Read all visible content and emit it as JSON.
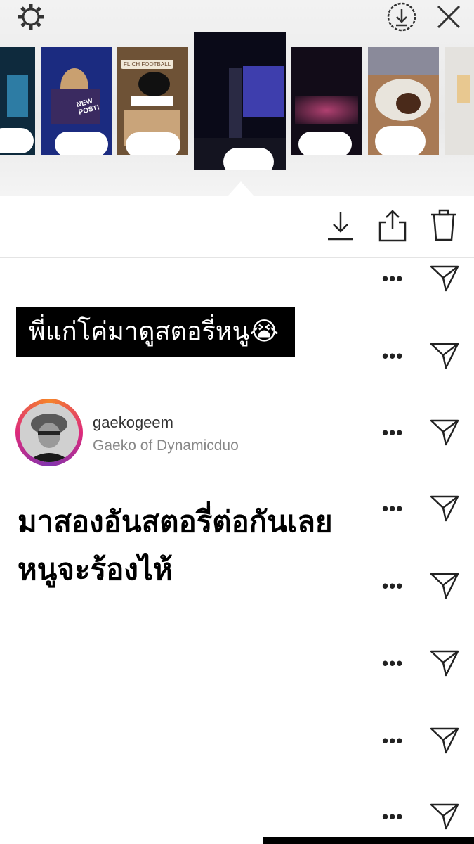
{
  "top_bar": {
    "settings_icon": "gear-icon",
    "save_icon": "download-circle-icon",
    "close_icon": "close-icon"
  },
  "stories": [
    {
      "overlay": "",
      "color": "#0d2a3a"
    },
    {
      "overlay": "NEW POST!",
      "color": "#1a2f7a"
    },
    {
      "overlay": "FLICH FOOTBALL",
      "color": "#7a5a3a"
    },
    {
      "overlay": "",
      "color": "#101022"
    },
    {
      "overlay": "",
      "color": "#1a1020"
    },
    {
      "overlay": "",
      "color": "#a07050"
    },
    {
      "overlay": "",
      "color": "#d8d8d8"
    }
  ],
  "actions": {
    "download_icon": "download-icon",
    "share_icon": "share-icon",
    "delete_icon": "trash-icon"
  },
  "viewers": [
    {
      "username": "gaekogeem",
      "full_name": "Gaeko of Dynamicduo"
    }
  ],
  "row_more_label": "•••",
  "caption_top": "พี่แก่โค่มาดูสตอรี่หนู😭",
  "caption_bottom_line1": "มาสองอันสตอรี่ต่อกันเลย",
  "caption_bottom_line2": "หนูจะร้องไห้"
}
